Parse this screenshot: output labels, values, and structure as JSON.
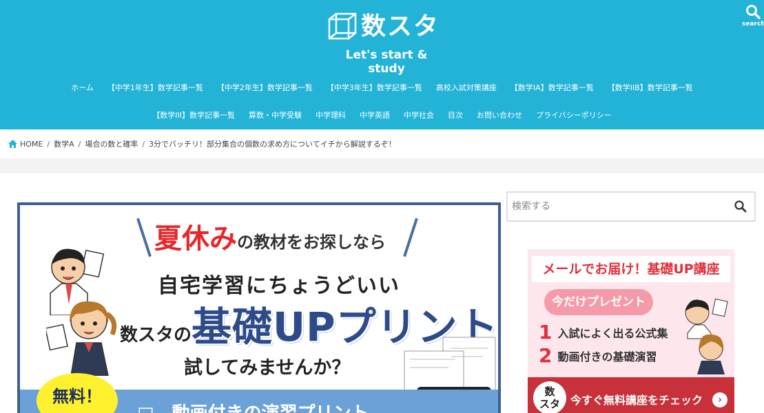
{
  "site": {
    "title": "数スタ",
    "tagline": "Let's start & study",
    "search_label": "search"
  },
  "nav": {
    "row1": [
      "ホーム",
      "【中学1年生】数学記事一覧",
      "【中学2年生】数学記事一覧",
      "【中学3年生】数学記事一覧",
      "高校入試対策講座",
      "【数学IA】数学記事一覧",
      "【数学IIB】数学記事一覧"
    ],
    "row2": [
      "【数学III】数学記事一覧",
      "算数・中学受験",
      "中学理科",
      "中学英語",
      "中学社会",
      "目次",
      "お問い合わせ",
      "プライバシーポリシー"
    ]
  },
  "breadcrumb": {
    "home": "HOME",
    "items": [
      "数学A",
      "場合の数と確率",
      "3分でバッチリ！部分集合の個数の求め方についてイチから解説するぞ！"
    ]
  },
  "banner": {
    "line1_red": "夏休み",
    "line1_rest": "の教材をお探しなら",
    "line2": "自宅学習にちょうどいい",
    "line3_small": "数スタの",
    "line3_big": "基礎UPプリント",
    "line4": "試してみませんか？",
    "free": "無料！",
    "bar_text": "□　動画付きの演習プリント"
  },
  "sidebar": {
    "search_placeholder": "検索する",
    "ad": {
      "heading": "メールでお届け！基礎UP講座",
      "pill": "今だけプレゼント",
      "items": [
        {
          "num": "1",
          "text": "入試によく出る公式集"
        },
        {
          "num": "2",
          "text": "動画付きの基礎演習"
        }
      ],
      "logo_line1": "数",
      "logo_line2": "スタ",
      "cta": "今すぐ無料講座をチェック",
      "arrow": "›"
    }
  },
  "colors": {
    "header_bg": "#22b3d6",
    "banner_border": "#3f5f91",
    "accent_red": "#e8262a",
    "sidebar_pink": "#fde7ec",
    "cta_red": "#c8313a"
  }
}
